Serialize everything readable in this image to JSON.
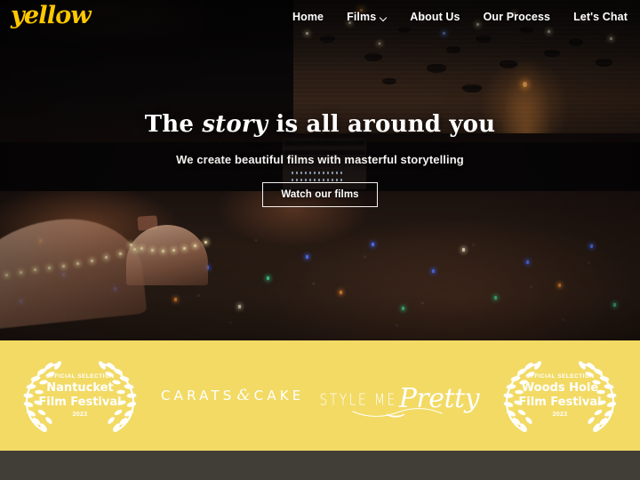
{
  "brand": {
    "logo_text_before": "yell",
    "logo_o": "o",
    "logo_text_after": "w",
    "logo_color": "#ffc800",
    "logo_icon": "play-triangle"
  },
  "nav": {
    "items": [
      {
        "label": "Home",
        "has_dropdown": false
      },
      {
        "label": "Films",
        "has_dropdown": true
      },
      {
        "label": "About Us",
        "has_dropdown": false
      },
      {
        "label": "Our Process",
        "has_dropdown": false
      },
      {
        "label": "Let's Chat",
        "has_dropdown": false
      }
    ]
  },
  "hero": {
    "title_part1": "The ",
    "title_emphasis": "story",
    "title_part2": " is all around you",
    "subtitle": "We create beautiful films with masterful storytelling",
    "cta_label": "Watch our films",
    "background": "night aerial photo of harbour, boats and festival crowd with tents"
  },
  "awards": {
    "background_color": "#f2da65",
    "items": [
      {
        "type": "laurel",
        "line1": "OFFICIAL SELECTION",
        "line2": "Nantucket",
        "line3": "Film Festival",
        "line4": "2023"
      },
      {
        "type": "wordmark",
        "name": "CARATS & CAKE",
        "word1": "CARATS",
        "ampersand": "&",
        "word2": "CAKE"
      },
      {
        "type": "wordmark",
        "name": "Style Me Pretty",
        "word1": "STYLE ME",
        "word2": "Pretty"
      },
      {
        "type": "laurel",
        "line1": "OFFICIAL SELECTION",
        "line2": "Woods Hole",
        "line3": "Film Festival",
        "line4": "2023"
      }
    ]
  },
  "footer": {
    "background_color": "#413d37"
  }
}
